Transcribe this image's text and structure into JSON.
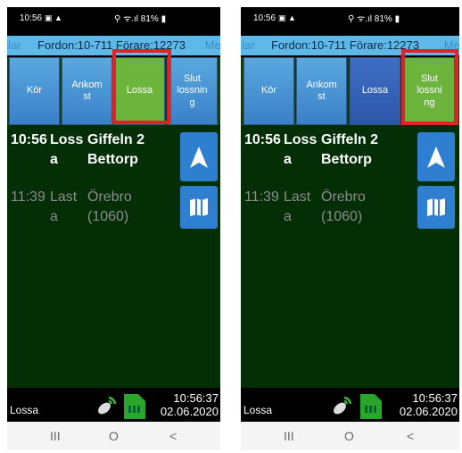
{
  "left": {
    "status": {
      "time": "10:56",
      "icons": "▣ ▲",
      "right": "⚲ ᯤ.ıl 81% ▮"
    },
    "info": {
      "prefix": "dlar",
      "vehicle_driver": "Fordon:10-711 Förare:12273",
      "suffix": "Med"
    },
    "buttons": [
      {
        "label": "Kör"
      },
      {
        "label": "Ankom\nst"
      },
      {
        "label": "Lossa"
      },
      {
        "label": "Slut\nlossnin\ng"
      }
    ],
    "rows": [
      {
        "time": "10:56",
        "type": "Loss\na",
        "place": "Giffeln 2\nBettorp"
      },
      {
        "time": "11:39",
        "type": "Last\na",
        "place": "Örebro\n(1060)"
      }
    ],
    "bottom": {
      "label": "Lossa",
      "clock_time": "10:56:37",
      "clock_date": "02.06.2020"
    },
    "nav": {
      "recent": "III",
      "home": "O",
      "back": "<"
    }
  },
  "right": {
    "status": {
      "time": "10:56",
      "icons": "▣ ▲",
      "right": "⚲ ᯤ.ıl 81% ▮"
    },
    "info": {
      "prefix": "dlar",
      "vehicle_driver": "Fordon:10-711 Förare:12273",
      "suffix": "Med"
    },
    "buttons": [
      {
        "label": "Kör"
      },
      {
        "label": "Ankom\nst"
      },
      {
        "label": "Lossa"
      },
      {
        "label": "Slut\nlossni\nng"
      }
    ],
    "rows": [
      {
        "time": "10:56",
        "type": "Loss\na",
        "place": "Giffeln 2\nBettorp"
      },
      {
        "time": "11:39",
        "type": "Last\na",
        "place": "Örebro\n(1060)"
      }
    ],
    "bottom": {
      "label": "Lossa",
      "clock_time": "10:56:37",
      "clock_date": "02.06.2020"
    },
    "nav": {
      "recent": "III",
      "home": "O",
      "back": "<"
    }
  },
  "colors": {
    "highlight": "#e0222a",
    "active_button": "#6cb43c",
    "button": "#4a90d9",
    "background": "#042e06",
    "infobar": "#5eb8e8"
  }
}
